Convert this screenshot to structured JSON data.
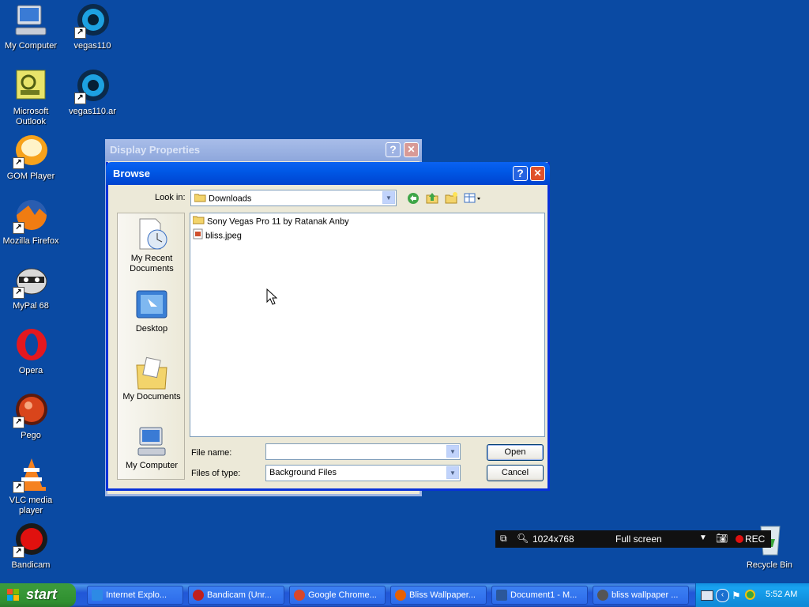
{
  "desktop": {
    "icons": [
      {
        "label": "My Computer",
        "icon": "my-computer-icon"
      },
      {
        "label": "vegas110",
        "icon": "vegas-icon"
      },
      {
        "label": "Microsoft Outlook",
        "icon": "outlook-icon"
      },
      {
        "label": "vegas110.ar",
        "icon": "vegas-icon"
      },
      {
        "label": "GOM Player",
        "icon": "gom-player-icon"
      },
      {
        "label": "Mozilla Firefox",
        "icon": "firefox-icon"
      },
      {
        "label": "MyPal 68",
        "icon": "mypal-icon"
      },
      {
        "label": "Opera",
        "icon": "opera-icon"
      },
      {
        "label": "Pego",
        "icon": "pego-icon"
      },
      {
        "label": "VLC media player",
        "icon": "vlc-icon"
      },
      {
        "label": "Bandicam",
        "icon": "bandicam-icon"
      },
      {
        "label": "Recycle Bin",
        "icon": "recycle-bin-icon"
      }
    ]
  },
  "display_properties": {
    "title": "Display Properties",
    "help": "?",
    "close": "✕"
  },
  "browse_dialog": {
    "title": "Browse",
    "help": "?",
    "close": "✕",
    "look_in_label": "Look in:",
    "look_in_value": "Downloads",
    "places": [
      {
        "label": "My Recent Documents",
        "icon": "recent-documents-icon"
      },
      {
        "label": "Desktop",
        "icon": "desktop-icon"
      },
      {
        "label": "My Documents",
        "icon": "my-documents-icon"
      },
      {
        "label": "My Computer",
        "icon": "my-computer-icon"
      }
    ],
    "files": [
      {
        "name": "Sony Vegas Pro 11 by Ratanak Anby",
        "icon": "folder-icon"
      },
      {
        "name": "bliss.jpeg",
        "icon": "image-file-icon"
      }
    ],
    "file_name_label": "File name:",
    "file_name_value": "",
    "files_of_type_label": "Files of type:",
    "files_of_type_value": "Background Files",
    "open_label": "Open",
    "cancel_label": "Cancel"
  },
  "bandicam_bar": {
    "resolution": "1024x768",
    "mode": "Full screen",
    "rec_label": "REC"
  },
  "taskbar": {
    "start_label": "start",
    "tasks": [
      {
        "label": "Internet Explo...",
        "color": "#2d8ae5"
      },
      {
        "label": "Bandicam (Unr...",
        "color": "#c0201d"
      },
      {
        "label": "Google Chrome...",
        "color": "#d9472b"
      },
      {
        "label": "Bliss Wallpaper...",
        "color": "#e66000"
      },
      {
        "label": "Document1 - M...",
        "color": "#2b579a"
      },
      {
        "label": "bliss wallpaper ...",
        "color": "#555"
      }
    ],
    "clock": "5:52 AM"
  }
}
